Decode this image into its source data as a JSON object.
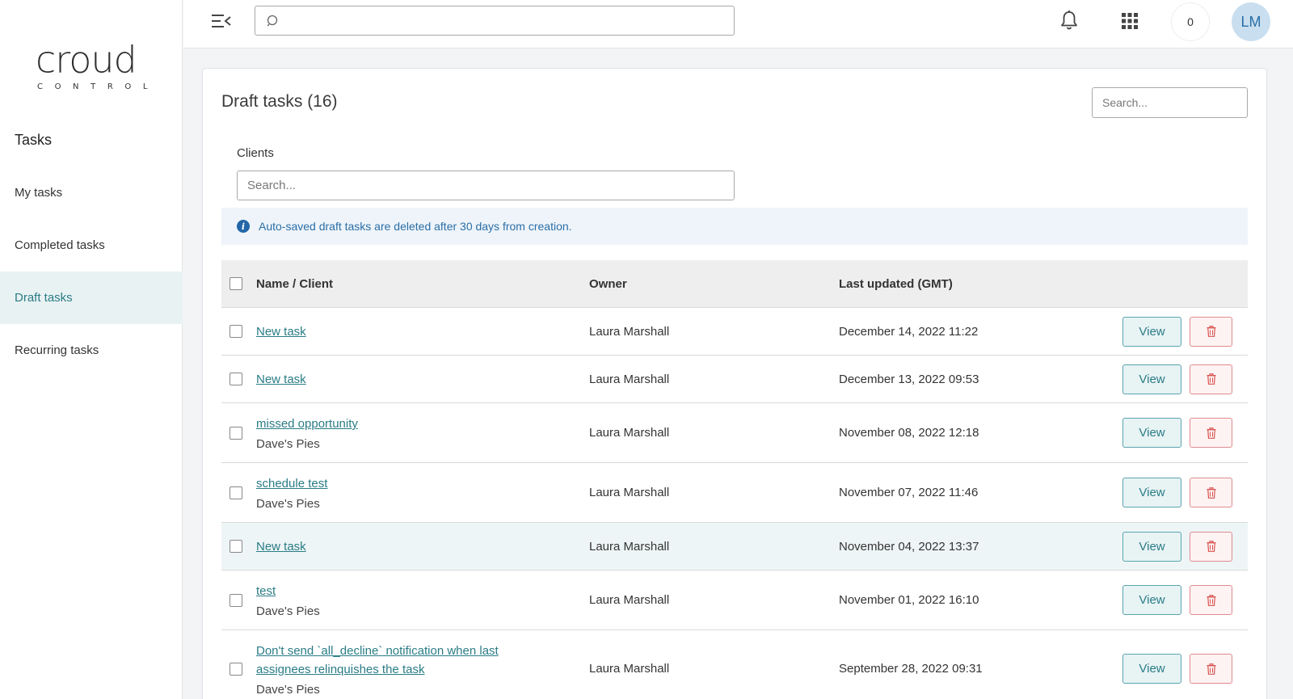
{
  "logo": {
    "word": "croud",
    "sub": "CONTROL"
  },
  "sidebar": {
    "heading": "Tasks",
    "items": [
      {
        "label": "My tasks",
        "active": false
      },
      {
        "label": "Completed tasks",
        "active": false
      },
      {
        "label": "Draft tasks",
        "active": true
      },
      {
        "label": "Recurring tasks",
        "active": false
      }
    ]
  },
  "topbar": {
    "search_value": "",
    "counter": "0",
    "avatar_initials": "LM",
    "icons": [
      "menu-collapse-icon",
      "search-icon",
      "bell-icon",
      "apps-grid-icon"
    ]
  },
  "main": {
    "title": "Draft tasks (16)",
    "search_placeholder": "Search...",
    "clients_label": "Clients",
    "clients_placeholder": "Search...",
    "info_text": "Auto-saved draft tasks are deleted after 30 days from creation.",
    "columns": {
      "name": "Name / Client",
      "owner": "Owner",
      "updated": "Last updated (GMT)"
    },
    "view_label": "View",
    "rows": [
      {
        "name": "New task",
        "client": "",
        "owner": "Laura Marshall",
        "updated": "December 14, 2022 11:22"
      },
      {
        "name": "New task",
        "client": "",
        "owner": "Laura Marshall",
        "updated": "December 13, 2022 09:53"
      },
      {
        "name": "missed opportunity",
        "client": "Dave's Pies",
        "owner": "Laura Marshall",
        "updated": "November 08, 2022 12:18"
      },
      {
        "name": "schedule test",
        "client": "Dave's Pies",
        "owner": "Laura Marshall",
        "updated": "November 07, 2022 11:46"
      },
      {
        "name": "New task",
        "client": "",
        "owner": "Laura Marshall",
        "updated": "November 04, 2022 13:37"
      },
      {
        "name": "test",
        "client": "Dave's Pies",
        "owner": "Laura Marshall",
        "updated": "November 01, 2022 16:10"
      },
      {
        "name": "Don't send `all_decline` notification when last assignees relinquishes the task",
        "client": "Dave's Pies",
        "owner": "Laura Marshall",
        "updated": "September 28, 2022 09:31"
      }
    ]
  },
  "colors": {
    "accent": "#2a7c86",
    "info": "#2b6ea7",
    "danger": "#d9534f",
    "active_bg": "#e9f2f3"
  }
}
